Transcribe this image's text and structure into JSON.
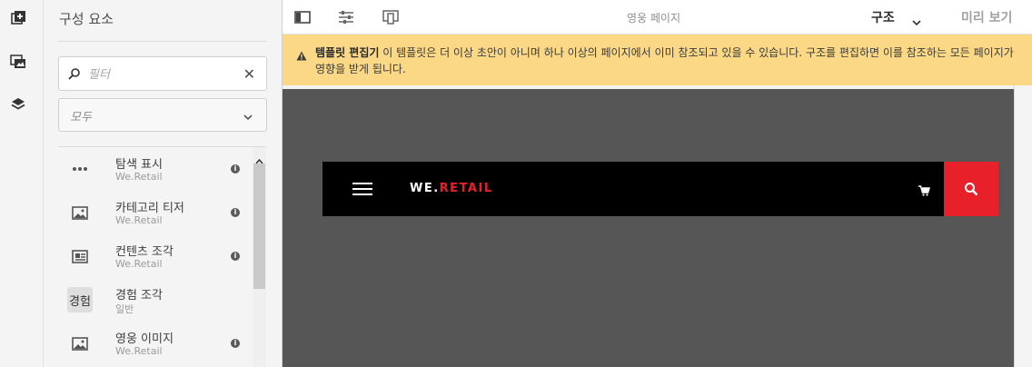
{
  "left_rail": {
    "icons": [
      "add-components-icon",
      "assets-icon",
      "layers-icon"
    ]
  },
  "panel": {
    "title": "구성 요소",
    "filter": {
      "placeholder": "필터",
      "value": ""
    },
    "group_select": {
      "value": "모두"
    },
    "items": [
      {
        "name": "탐색 표시",
        "group": "We.Retail",
        "icon": "more-horizontal-icon",
        "thumb_text": "",
        "info": true
      },
      {
        "name": "카테고리 티저",
        "group": "We.Retail",
        "icon": "image-icon",
        "thumb_text": "",
        "info": true
      },
      {
        "name": "컨텐츠 조각",
        "group": "We.Retail",
        "icon": "content-fragment-icon",
        "thumb_text": "",
        "info": true
      },
      {
        "name": "경험 조각",
        "group": "일반",
        "icon": "text-thumb",
        "thumb_text": "경험",
        "info": false
      },
      {
        "name": "영웅 이미지",
        "group": "We.Retail",
        "icon": "image-icon",
        "thumb_text": "",
        "info": true
      }
    ]
  },
  "toolbar": {
    "icons": [
      "toggle-side-panel-icon",
      "page-properties-icon",
      "emulator-icon"
    ],
    "page_title": "영웅 페이지",
    "mode_label": "구조",
    "preview_label": "미리 보기"
  },
  "alert": {
    "title": "템플릿 편집기",
    "message": " 이 템플릿은 더 이상 초안이 아니며 하나 이상의 페이지에서 이미 참조되고 있을 수 있습니다. 구조를 편집하면 이를 참조하는 모든 페이지가 영향을 받게 됩니다."
  },
  "site_header": {
    "logo_part1": "WE.",
    "logo_part2": "RETAIL"
  },
  "colors": {
    "alert_bg": "#fbd885",
    "canvas_bg": "#565656",
    "brand_red": "#e8202a",
    "header_bg": "#000000"
  }
}
